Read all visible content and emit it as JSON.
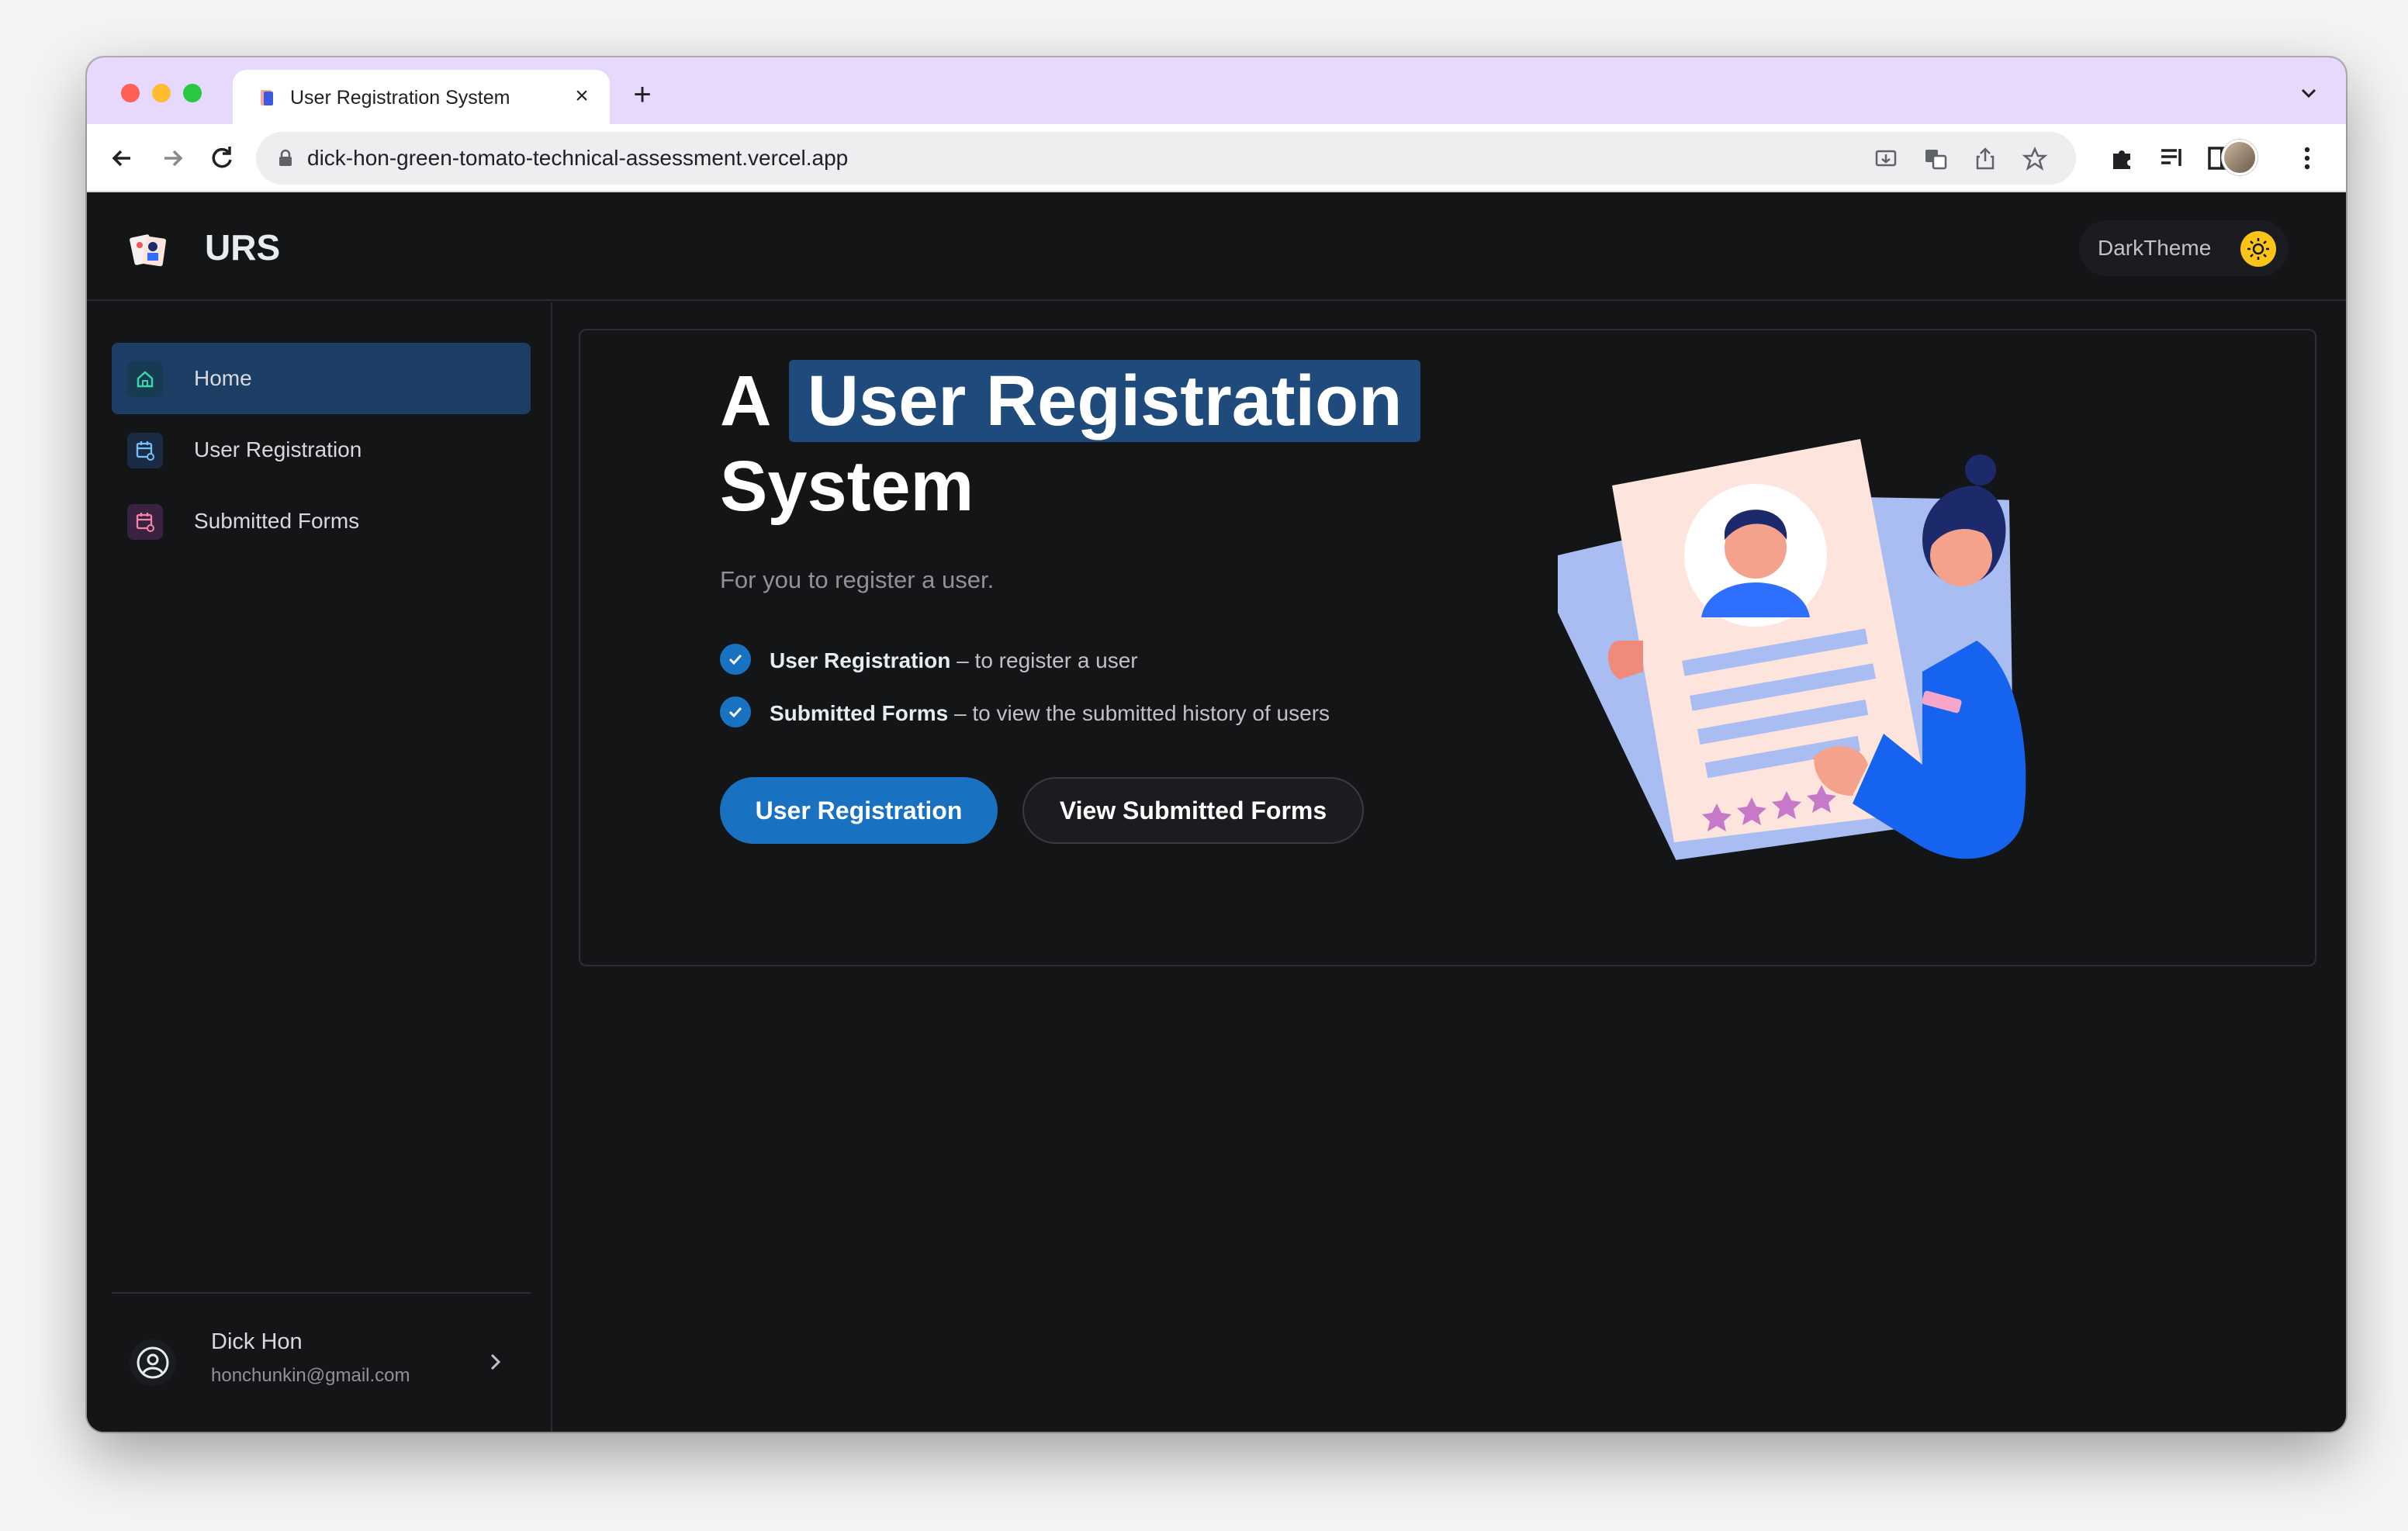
{
  "browser": {
    "tab_title": "User Registration System",
    "url": "dick-hon-green-tomato-technical-assessment.vercel.app"
  },
  "header": {
    "brand": "URS",
    "theme_label": "DarkTheme"
  },
  "sidebar": {
    "items": [
      {
        "label": "Home",
        "icon": "home-icon",
        "active": true
      },
      {
        "label": "User Registration",
        "icon": "calendar-icon"
      },
      {
        "label": "Submitted Forms",
        "icon": "calendar-icon"
      }
    ],
    "user": {
      "name": "Dick Hon",
      "email": "honchunkin@gmail.com"
    }
  },
  "hero": {
    "title_prefix": "A",
    "title_highlight": "User Registration",
    "title_suffix": "System",
    "subtitle": "For you to register a user.",
    "features": [
      {
        "bold": "User Registration",
        "text": " – to register a user"
      },
      {
        "bold": "Submitted Forms",
        "text": " – to view the submitted history of users"
      }
    ],
    "primary_button": "User Registration",
    "secondary_button": "View Submitted Forms"
  },
  "colors": {
    "accent": "#1971c2",
    "highlight": "#1e4a7c",
    "background": "#141517",
    "tab_strip": "#e6d9fb"
  }
}
